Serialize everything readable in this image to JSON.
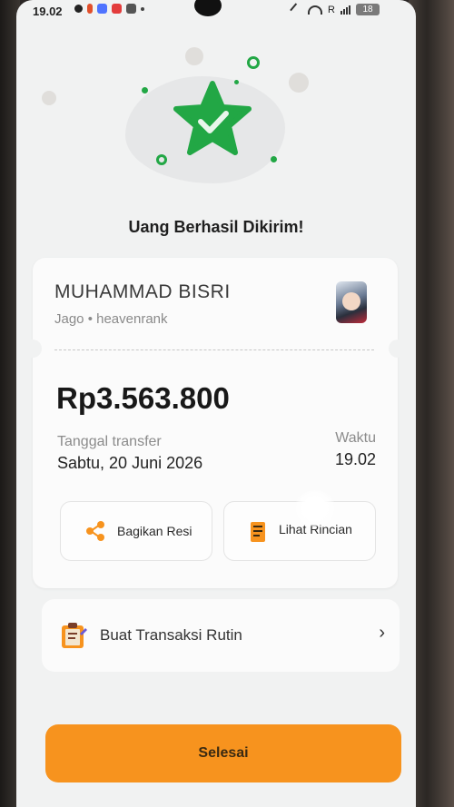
{
  "status_bar": {
    "time": "19.02",
    "carrier": "R",
    "battery": "18"
  },
  "headline": "Uang Berhasil Dikirim!",
  "recipient": {
    "name": "MUHAMMAD BISRI",
    "bank_and_user": "Jago • heavenrank"
  },
  "transfer": {
    "amount": "Rp3.563.800",
    "date_label": "Tanggal transfer",
    "date_value": "Sabtu, 20 Juni 2026",
    "time_label": "Waktu",
    "time_value": "19.02"
  },
  "actions": {
    "share_label": "Bagikan Resi",
    "detail_label": "Lihat Rincian"
  },
  "routine": {
    "label": "Buat Transaksi Rutin",
    "chevron": "›"
  },
  "done_label": "Selesai",
  "colors": {
    "success_green": "#22a745",
    "accent_orange": "#f7931e"
  },
  "icons": [
    "star-check-icon",
    "share-icon",
    "receipt-icon",
    "clipboard-icon",
    "chevron-right-icon"
  ]
}
